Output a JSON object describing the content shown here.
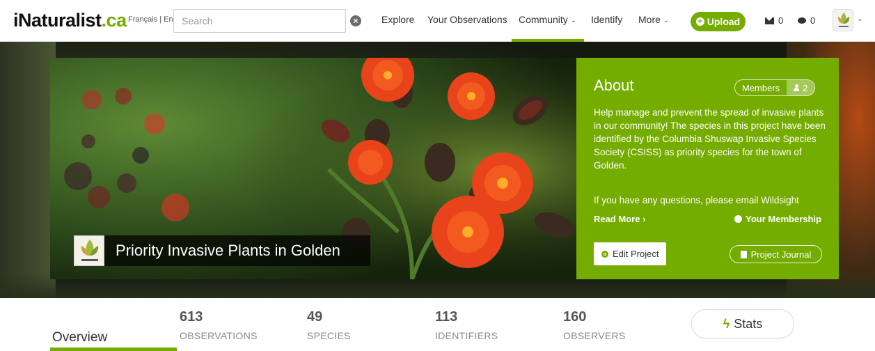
{
  "header": {
    "logo_part1": "iNaturalist",
    "logo_part2": ".ca",
    "language_links": "Français | English",
    "search_placeholder": "Search",
    "nav": [
      {
        "label": "Explore",
        "dropdown": false
      },
      {
        "label": "Your Observations",
        "dropdown": false
      },
      {
        "label": "Community",
        "dropdown": true,
        "active": true
      },
      {
        "label": "Identify",
        "dropdown": false
      },
      {
        "label": "More",
        "dropdown": true
      }
    ],
    "upload_label": "Upload",
    "messages_count": "0",
    "notifications_count": "0"
  },
  "project": {
    "title": "Priority Invasive Plants in Golden",
    "about": {
      "heading": "About",
      "members_label": "Members",
      "members_count": "2",
      "description": "Help manage and prevent the spread of invasive plants in our community! The species in this project have been identified by the Columbia Shuswap Invasive Species Society (CSISS) as priority species for the town of Golden.",
      "question_line": "If you have any questions, please email Wildsight",
      "read_more": "Read More ›",
      "your_membership": "Your Membership",
      "edit_project": "Edit Project",
      "project_journal": "Project Journal"
    }
  },
  "stats": {
    "tab_overview": "Overview",
    "items": [
      {
        "value": "613",
        "label": "OBSERVATIONS"
      },
      {
        "value": "49",
        "label": "SPECIES"
      },
      {
        "value": "113",
        "label": "IDENTIFIERS"
      },
      {
        "value": "160",
        "label": "OBSERVERS"
      }
    ],
    "stats_button": "Stats"
  },
  "colors": {
    "accent": "#74ac00",
    "flower": "#e8431a"
  },
  "icons": {
    "clear": "close-circle-icon",
    "upload": "plus-circle-icon",
    "messages": "envelope-icon",
    "notifications": "chat-icon",
    "members": "user-icon",
    "membership": "gear-icon",
    "edit": "gear-icon",
    "journal": "book-icon",
    "stats": "bolt-icon"
  }
}
